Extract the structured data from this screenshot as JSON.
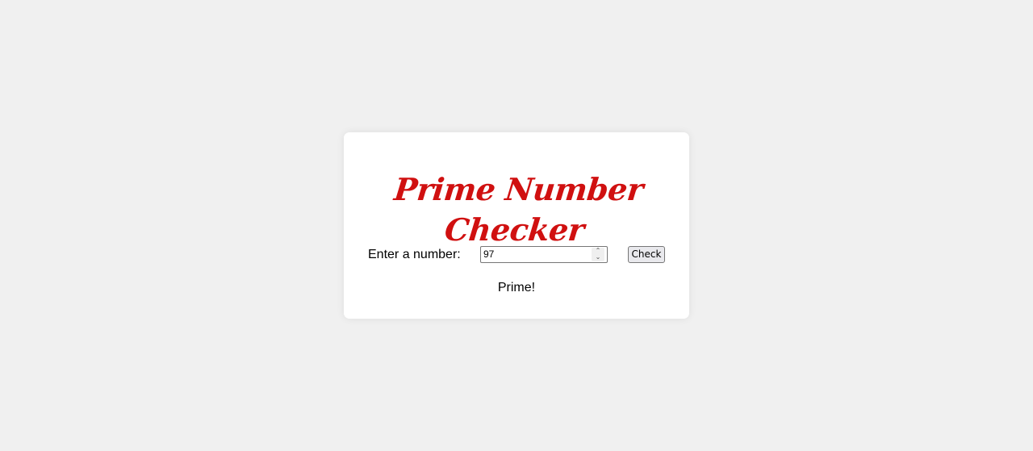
{
  "app": {
    "title": "Prime Number Checker"
  },
  "form": {
    "label": "Enter a number:",
    "input_value": "97",
    "spin_up_icon": "chevron-up-icon",
    "spin_down_icon": "chevron-down-icon",
    "check_label": "Check"
  },
  "result": {
    "text": "Prime!"
  },
  "colors": {
    "page_background": "#f0f0f0",
    "card_background": "#ffffff",
    "title_color": "#d01010",
    "button_background": "#e9e9ed"
  }
}
